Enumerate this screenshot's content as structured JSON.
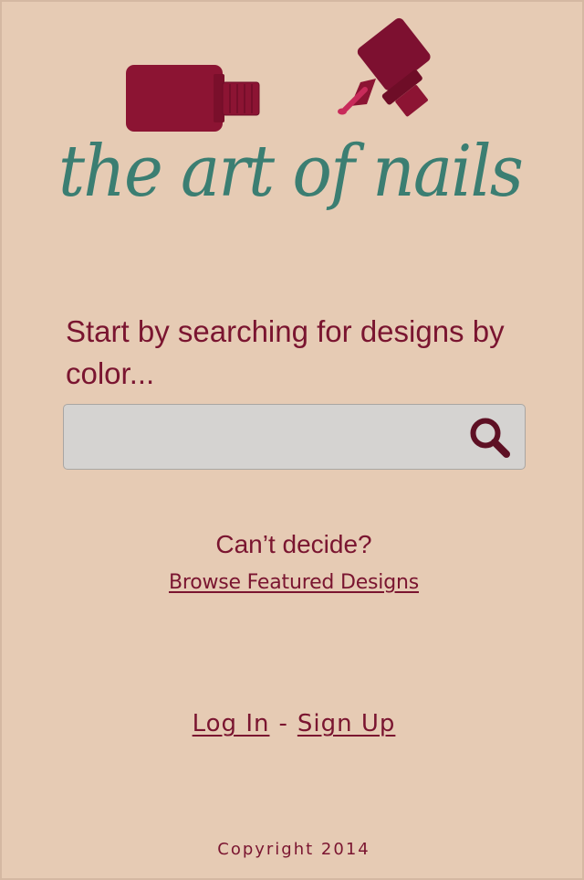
{
  "header": {
    "logo_text": "the art of nails"
  },
  "search": {
    "prompt": "Start by searching for designs by color...",
    "value": "",
    "placeholder": "",
    "button_icon": "search-icon"
  },
  "featured": {
    "question": "Can’t decide?",
    "link_label": "Browse Featured Designs"
  },
  "auth": {
    "login_label": "Log In",
    "separator": "-",
    "signup_label": "Sign Up"
  },
  "footer": {
    "copyright": "Copyright 2014"
  },
  "colors": {
    "background": "#e6cbb4",
    "brand_text": "#7a1530",
    "logo_text": "#3b7e72",
    "bottle": "#8c1433",
    "bottle_brush": "#c82b5a",
    "search_box": "#d5d3d1",
    "search_icon": "#5e1024"
  }
}
